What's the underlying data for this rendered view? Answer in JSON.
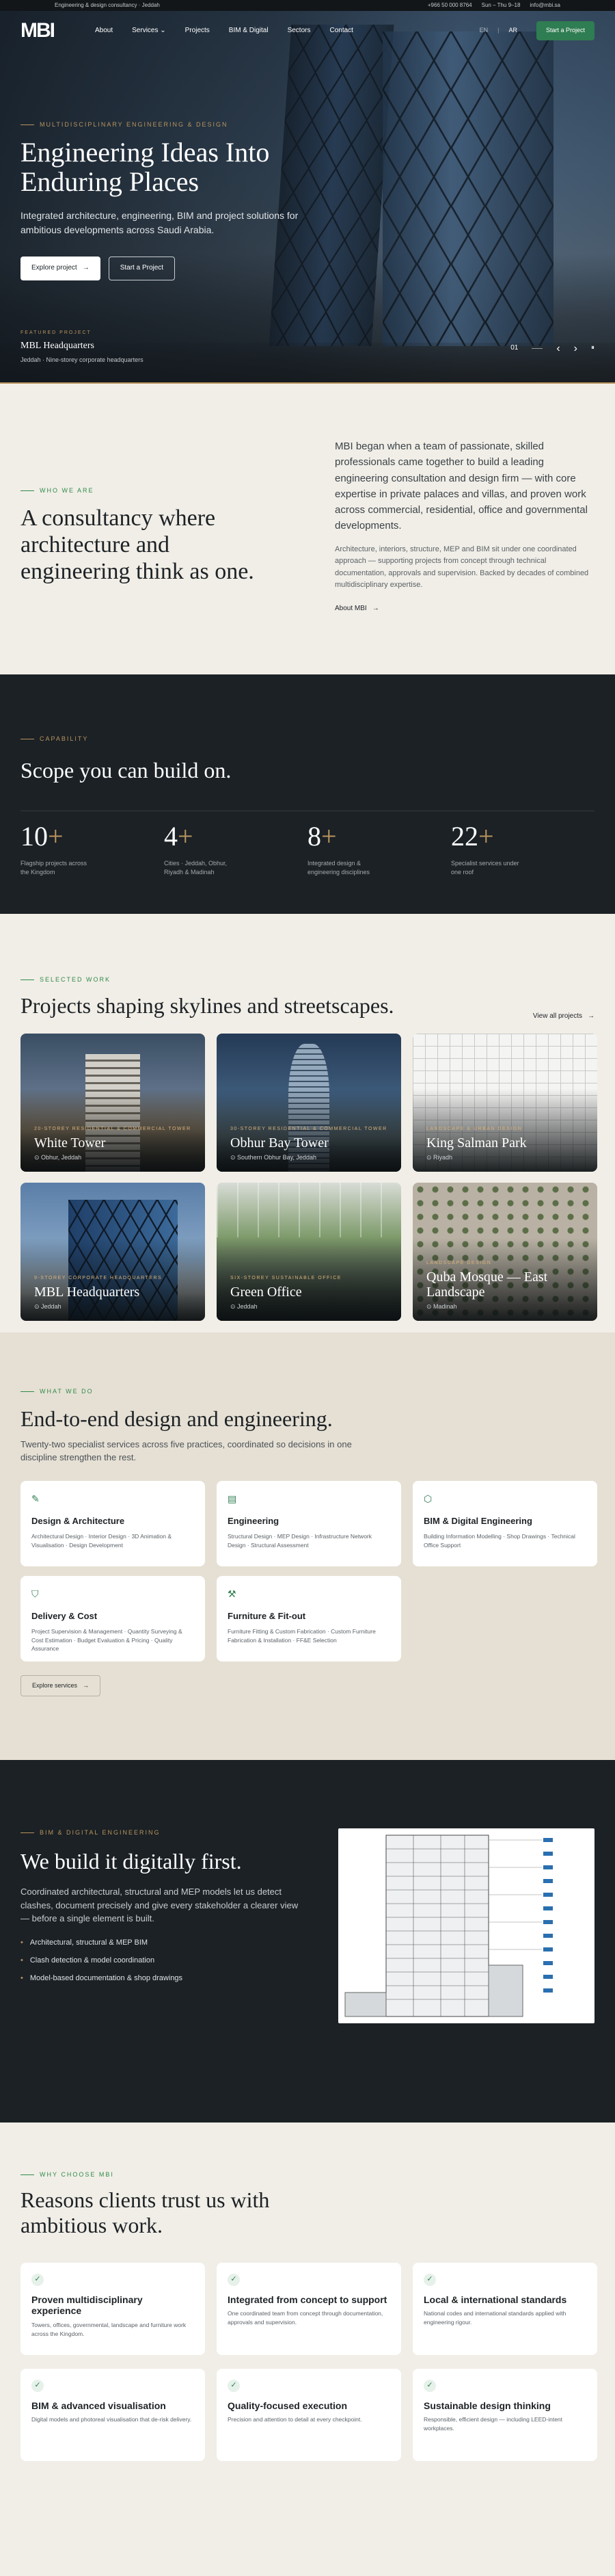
{
  "topbar": {
    "tagline": "Engineering & design consultancy · Jeddah",
    "phone": "+966 50 000 8764",
    "hours": "Sun – Thu 9–18",
    "email": "info@mbi.sa"
  },
  "nav": {
    "logo": "MBI",
    "links": [
      "About",
      "Services ⌄",
      "Projects",
      "BIM & Digital",
      "Sectors",
      "Contact"
    ],
    "lang_en": "EN",
    "lang_ar": "AR",
    "cta": "Start a Project"
  },
  "hero": {
    "eyebrow": "MULTIDISCIPLINARY ENGINEERING & DESIGN",
    "title": "Engineering Ideas Into Enduring Places",
    "lead": "Integrated architecture, engineering, BIM and project solutions for ambitious developments across Saudi Arabia.",
    "btn_primary": "Explore project",
    "btn_secondary": "Start a Project",
    "featured_label": "FEATURED PROJECT",
    "featured_title": "MBL Headquarters",
    "featured_sub": "Jeddah · Nine-storey corporate headquarters",
    "counter": "01",
    "prev": "‹",
    "next": "›",
    "pause": "⏸"
  },
  "about": {
    "eyebrow": "WHO WE ARE",
    "title": "A consultancy where architecture and engineering think as one.",
    "lead": "MBI began when a team of passionate, skilled professionals came together to build a leading engineering consultation and design firm — with core expertise in private palaces and villas, and proven work across commercial, residential, office and governmental developments.",
    "sub": "Architecture, interiors, structure, MEP and BIM sit under one coordinated approach — supporting projects from concept through technical documentation, approvals and supervision. Backed by decades of combined multidisciplinary expertise.",
    "more": "About MBI"
  },
  "capability": {
    "eyebrow": "CAPABILITY",
    "title": "Scope you can build on.",
    "stats": [
      {
        "num": "10",
        "label": "Flagship projects across the Kingdom"
      },
      {
        "num": "4",
        "label": "Cities · Jeddah, Obhur, Riyadh & Madinah"
      },
      {
        "num": "8",
        "label": "Integrated design & engineering disciplines"
      },
      {
        "num": "22",
        "label": "Specialist services under one roof"
      }
    ]
  },
  "projects": {
    "eyebrow": "SELECTED WORK",
    "title": "Projects shaping skylines and streetscapes.",
    "view_all": "View all projects",
    "items": [
      {
        "cat": "20-STOREY RESIDENTIAL & COMMERCIAL TOWER",
        "name": "White Tower",
        "loc": "Obhur, Jeddah"
      },
      {
        "cat": "30-STOREY RESIDENTIAL & COMMERCIAL TOWER",
        "name": "Obhur Bay Tower",
        "loc": "Southern Obhur Bay, Jeddah"
      },
      {
        "cat": "LANDSCAPE & URBAN DESIGN",
        "name": "King Salman Park",
        "loc": "Riyadh"
      },
      {
        "cat": "9-STOREY CORPORATE HEADQUARTERS",
        "name": "MBL Headquarters",
        "loc": "Jeddah"
      },
      {
        "cat": "SIX-STOREY SUSTAINABLE OFFICE",
        "name": "Green Office",
        "loc": "Jeddah"
      },
      {
        "cat": "LANDSCAPE DESIGN",
        "name": "Quba Mosque — East Landscape",
        "loc": "Madinah"
      }
    ]
  },
  "services": {
    "eyebrow": "WHAT WE DO",
    "title": "End-to-end design and engineering.",
    "lead": "Twenty-two specialist services across five practices, coordinated so decisions in one discipline strengthen the rest.",
    "items": [
      {
        "title": "Design & Architecture",
        "desc": "Architectural Design · Interior Design · 3D Animation & Visualisation · Design Development"
      },
      {
        "title": "Engineering",
        "desc": "Structural Design · MEP Design · Infrastructure Network Design · Structural Assessment"
      },
      {
        "title": "BIM & Digital Engineering",
        "desc": "Building Information Modelling · Shop Drawings · Technical Office Support"
      },
      {
        "title": "Delivery & Cost",
        "desc": "Project Supervision & Management · Quantity Surveying & Cost Estimation · Budget Evaluation & Pricing · Quality Assurance"
      },
      {
        "title": "Furniture & Fit-out",
        "desc": "Furniture Fitting & Custom Fabrication · Custom Furniture Fabrication & Installation · FF&E Selection"
      }
    ],
    "explore": "Explore services"
  },
  "bim": {
    "eyebrow": "BIM & DIGITAL ENGINEERING",
    "title": "We build it digitally first.",
    "lead": "Coordinated architectural, structural and MEP models let us detect clashes, document precisely and give every stakeholder a clearer view — before a single element is built.",
    "points": [
      "Architectural, structural & MEP BIM",
      "Clash detection & model coordination",
      "Model-based documentation & shop drawings"
    ]
  },
  "why": {
    "eyebrow": "WHY CHOOSE MBI",
    "title": "Reasons clients trust us with ambitious work.",
    "items": [
      {
        "title": "Proven multidisciplinary experience",
        "desc": "Towers, offices, governmental, landscape and furniture work across the Kingdom."
      },
      {
        "title": "Integrated from concept to support",
        "desc": "One coordinated team from concept through documentation, approvals and supervision."
      },
      {
        "title": "Local & international standards",
        "desc": "National codes and international standards applied with engineering rigour."
      },
      {
        "title": "BIM & advanced visualisation",
        "desc": "Digital models and photoreal visualisation that de-risk delivery."
      },
      {
        "title": "Quality-focused execution",
        "desc": "Precision and attention to detail at every checkpoint."
      },
      {
        "title": "Sustainable design thinking",
        "desc": "Responsible, efficient design — including LEED-intent workplaces."
      }
    ]
  }
}
